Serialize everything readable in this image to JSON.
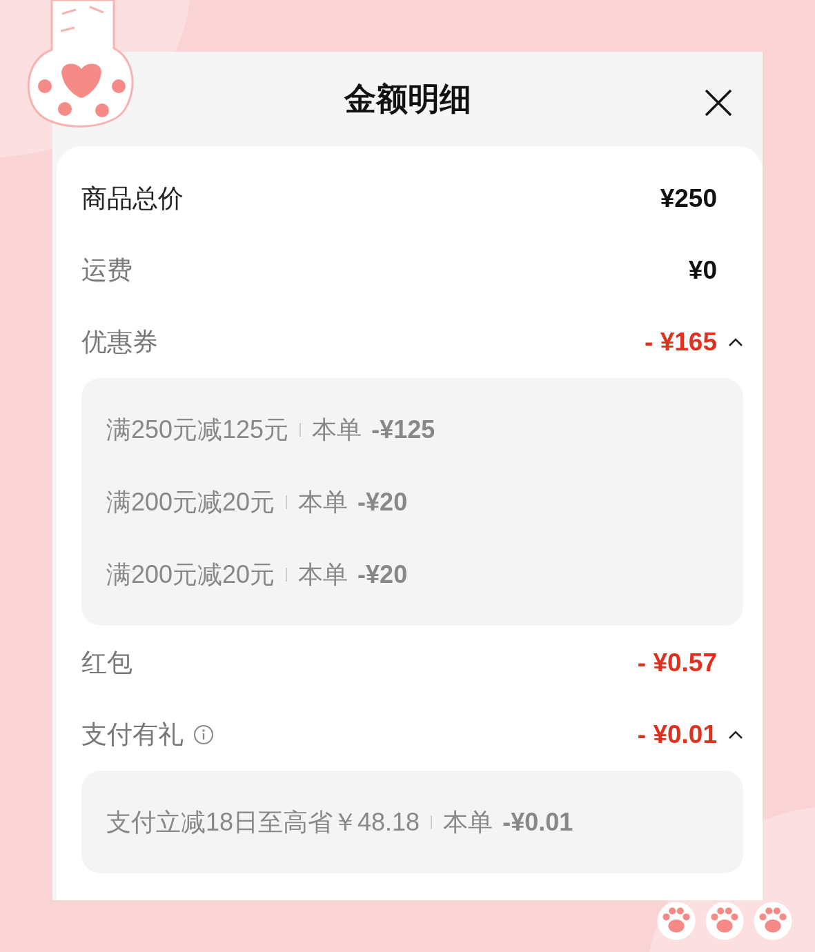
{
  "dialog": {
    "title": "金额明细"
  },
  "rows": [
    {
      "label": "商品总价",
      "value": "¥250",
      "kind": "total"
    },
    {
      "label": "运费",
      "value": "¥0",
      "kind": "plain"
    },
    {
      "label": "优惠券",
      "value": "- ¥165",
      "kind": "discount",
      "expanded": true,
      "details": [
        {
          "name": "满250元减125元",
          "order_label": "本单",
          "amount": "-¥125"
        },
        {
          "name": "满200元减20元",
          "order_label": "本单",
          "amount": "-¥20"
        },
        {
          "name": "满200元减20元",
          "order_label": "本单",
          "amount": "-¥20"
        }
      ]
    },
    {
      "label": "红包",
      "value": "- ¥0.57",
      "kind": "discount"
    },
    {
      "label": "支付有礼",
      "value": "- ¥0.01",
      "kind": "discount",
      "info": true,
      "expanded": true,
      "details": [
        {
          "name": "支付立减18日至高省￥48.18",
          "order_label": "本单",
          "amount": "-¥0.01"
        }
      ]
    }
  ]
}
